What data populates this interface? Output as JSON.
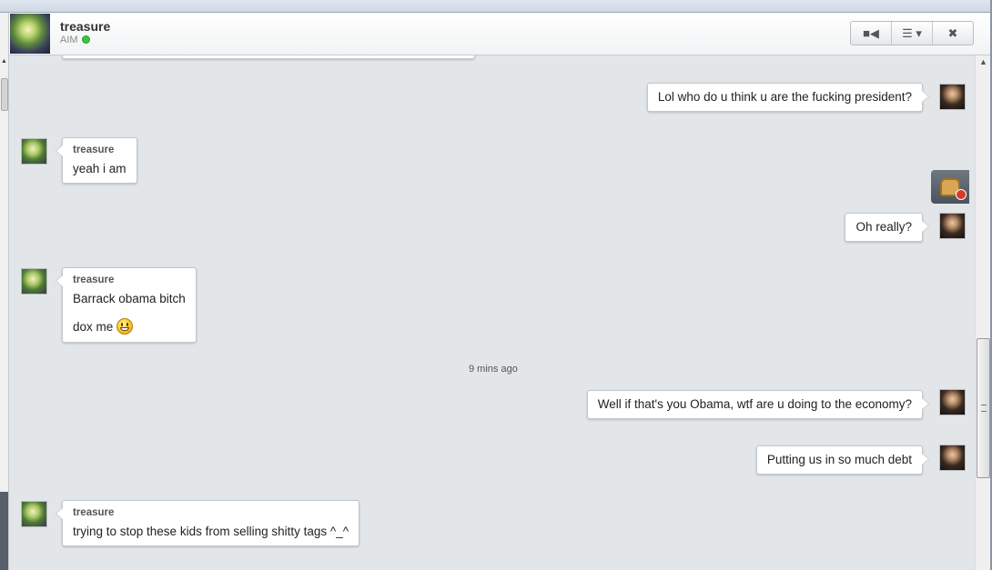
{
  "header": {
    "buddy_name": "treasure",
    "service": "AIM",
    "status_color": "#3cc73a",
    "buttons": [
      {
        "name": "video-call-button",
        "icon": "video-camera-icon",
        "glyph": "■◀"
      },
      {
        "name": "options-menu-button",
        "icon": "list-menu-icon",
        "glyph": "☰ ▾"
      },
      {
        "name": "close-chat-button",
        "icon": "close-icon",
        "glyph": "✖"
      }
    ]
  },
  "messages": {
    "m1": "Lol who do u think u are the fucking president?",
    "m2_sender": "treasure",
    "m2": "yeah i am",
    "m3": "Oh really?",
    "m4_sender": "treasure",
    "m4_line1": "Barrack obama bitch",
    "m4_line2": "dox me",
    "timestamp": "9 mins ago",
    "m5": "Well if that's you Obama, wtf are u doing to the economy?",
    "m6": "Putting us in so much debt",
    "m7_sender": "treasure",
    "m7": "trying to stop these kids from selling shitty tags ^_^"
  },
  "icons": {
    "smiley": "smiley-emoticon-icon",
    "toast": "toast-recording-icon"
  }
}
